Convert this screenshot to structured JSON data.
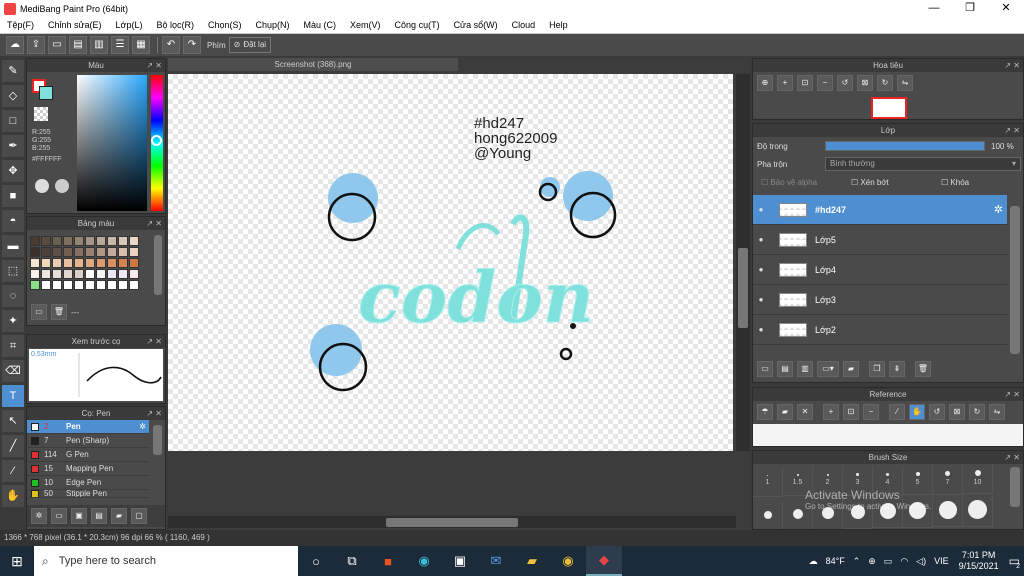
{
  "window": {
    "title": "MediBang Paint Pro (64bit)",
    "min": "—",
    "max": "❐",
    "close": "✕"
  },
  "menu": [
    "Tệp(F)",
    "Chỉnh sửa(E)",
    "Lớp(L)",
    "Bộ lọc(R)",
    "Chọn(S)",
    "Chụp(N)",
    "Màu (C)",
    "Xem(V)",
    "Công cụ(T)",
    "Cửa sổ(W)",
    "Cloud",
    "Help"
  ],
  "toolbar": {
    "key_label": "Phím",
    "reset_label": "Đặt lại"
  },
  "color_panel": {
    "title": "Màu",
    "r": "R:255",
    "g": "G:255",
    "b": "B:255",
    "hex": "#FFFFFF"
  },
  "palette_panel": {
    "title": "Bảng màu",
    "palette_label": "---",
    "swatches": [
      "#4a3a30",
      "#5b4b3d",
      "#6e5e4e",
      "#807060",
      "#938373",
      "#a69686",
      "#b8a898",
      "#c8b8a8",
      "#d8c8b8",
      "#e8d8c8",
      "#3a302a",
      "#4c4038",
      "#604f44",
      "#735f52",
      "#877063",
      "#9b8373",
      "#b09685",
      "#c4aa98",
      "#d8beac",
      "#ecd2c0",
      "#f4e4d0",
      "#f0d8b8",
      "#ecccb0",
      "#e8c0a0",
      "#e4b490",
      "#e0a880",
      "#dc9c70",
      "#d89060",
      "#d48450",
      "#d07840",
      "#f8f0e8",
      "#f0e8e0",
      "#e8e0d8",
      "#e0d8d0",
      "#d8d0c8",
      "#ffffff",
      "#f4f4f4",
      "#e8e8f8",
      "#f0e8f4",
      "#fce8f0",
      "#88e088",
      "#ffffff",
      "#ffffff",
      "#ffffff",
      "#ffffff",
      "#ffffff",
      "#ffffff",
      "#ffffff",
      "#ffffff",
      "#ffffff"
    ]
  },
  "preview_panel": {
    "title": "Xem trước cọ",
    "size": "0.53mm"
  },
  "brush_panel": {
    "title": "Cọ: Pen",
    "items": [
      {
        "size": "2",
        "name": "Pen",
        "color": "#ffffff"
      },
      {
        "size": "7",
        "name": "Pen (Sharp)",
        "color": "#222222"
      },
      {
        "size": "114",
        "name": "G Pen",
        "color": "#e03030"
      },
      {
        "size": "15",
        "name": "Mapping Pen",
        "color": "#e03030"
      },
      {
        "size": "10",
        "name": "Edge Pen",
        "color": "#20c020"
      },
      {
        "size": "50",
        "name": "Stipple Pen",
        "color": "#e0c020"
      }
    ]
  },
  "document": {
    "tab": "Screenshot (368).png",
    "canvas_text": [
      "#hd247",
      "hong622009",
      "@Young"
    ],
    "art_text": "codon"
  },
  "navigator_panel": {
    "title": "Hoa tiêu"
  },
  "layer_panel": {
    "title": "Lớp",
    "opacity_label": "Độ trong",
    "opacity_value": "100 %",
    "opacity": 1.0,
    "blend_label": "Pha trộn",
    "blend_value": "Bình thường",
    "protect_alpha": "Bảo vệ alpha",
    "clipping": "Xén bớt",
    "lock": "Khóa",
    "layers": [
      {
        "name": "#hd247",
        "active": true
      },
      {
        "name": "Lớp5",
        "active": false
      },
      {
        "name": "Lớp4",
        "active": false
      },
      {
        "name": "Lớp3",
        "active": false
      },
      {
        "name": "Lớp2",
        "active": false
      }
    ]
  },
  "reference_panel": {
    "title": "Reference"
  },
  "brush_size_panel": {
    "title": "Brush Size",
    "sizes_row1": [
      "1",
      "1.5",
      "2",
      "3",
      "4",
      "5",
      "7",
      "10"
    ],
    "watermark_title": "Activate Windows",
    "watermark_sub": "Go to Settings to activate Windows."
  },
  "status": {
    "text": "1366 * 768 pixel   (36.1 * 20.3cm)   96 dpi   66 %   ( 1160, 469 )"
  },
  "taskbar": {
    "search_placeholder": "Type here to search",
    "weather": "84°F",
    "lang": "VIE",
    "time": "7:01 PM",
    "date": "9/15/2021",
    "notif_count": "2"
  },
  "colors": {
    "accent": "#4d8fd1",
    "bubble": "#8fc8ec",
    "art": "#7fe0dc"
  }
}
